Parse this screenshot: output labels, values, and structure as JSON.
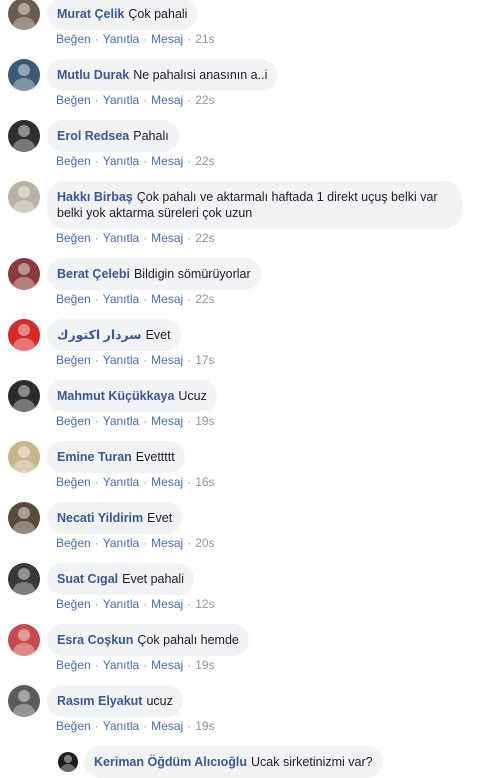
{
  "labels": {
    "like": "Beğen",
    "reply": "Yanıtla",
    "message": "Mesaj",
    "sep": "·"
  },
  "comments": [
    {
      "name": "Murat Çelik",
      "text": "Çok pahali",
      "time": "21s"
    },
    {
      "name": "Mutlu Durak",
      "text": "Ne pahalısi anasının a..i",
      "time": "22s"
    },
    {
      "name": "Erol Redsea",
      "text": "Pahalı",
      "time": "22s"
    },
    {
      "name": "Hakkı Birbaş",
      "text": "Çok pahalı ve aktarmalı haftada 1 direkt uçuş belki var belki yok aktarma süreleri çok uzun",
      "time": "22s"
    },
    {
      "name": "Berat Çelebi",
      "text": "Bildigin sömürüyorlar",
      "time": "22s"
    },
    {
      "name": "سردار اكتورك",
      "text": "Evet",
      "time": "17s"
    },
    {
      "name": "Mahmut Küçükkaya",
      "text": "Ucuz",
      "time": "19s"
    },
    {
      "name": "Emine Turan",
      "text": "Evettttt",
      "time": "16s"
    },
    {
      "name": "Necati Yildirim",
      "text": "Evet",
      "time": "20s"
    },
    {
      "name": "Suat Cıgal",
      "text": "Evet pahali",
      "time": "12s"
    },
    {
      "name": "Esra Coşkun",
      "text": "Çok pahalı hemde",
      "time": "19s"
    },
    {
      "name": "Rasım Elyakut",
      "text": "ucuz",
      "time": "19s"
    }
  ],
  "reply": {
    "name": "Keriman Öğdüm Alıcıoğlu",
    "text": "Ucak sirketinizmi var?"
  },
  "colors": {
    "link": "#385898",
    "bubble": "#f2f3f5",
    "avatars": [
      "#6b5a4e",
      "#3b5a7a",
      "#2f2f2f",
      "#b9b1a3",
      "#8a3a3a",
      "#d62b2b",
      "#2b2b2b",
      "#c8b58a",
      "#5a4a3a",
      "#3a3a3a",
      "#c94a4a",
      "#5b5b5b",
      "#1d1d1d"
    ]
  }
}
